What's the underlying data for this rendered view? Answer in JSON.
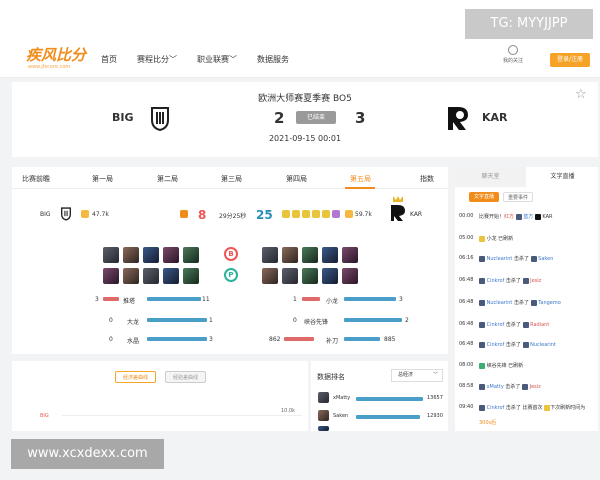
{
  "watermarks": {
    "top_right": "TG: MYYJJPP",
    "bottom_left": "www.xcxdexx.com"
  },
  "header": {
    "logo": "疾风比分",
    "logo_sub": "www.jfscore.com",
    "nav": [
      "首页",
      "赛程比分",
      "职业联赛",
      "数据服务"
    ],
    "follow_label": "我的关注",
    "login_label": "登录/注册"
  },
  "match": {
    "title": "欧洲大师赛夏季赛 BO5",
    "team_left": "BIG",
    "team_right": "KAR",
    "score_left": "2",
    "score_right": "3",
    "status": "已结束",
    "time": "2021-09-15 00:01"
  },
  "stats": {
    "tabs": [
      "比赛前瞻",
      "第一局",
      "第二局",
      "第三局",
      "第四局",
      "第五局",
      "指数"
    ],
    "active_tab": "第五局",
    "summary": {
      "left_team": "BIG",
      "left_gold": "47.7k",
      "left_kills": "8",
      "duration": "29分25秒",
      "right_kills": "25",
      "right_gold": "59.7k",
      "right_team": "KAR"
    },
    "side_badges": [
      "B",
      "P"
    ],
    "left_bars": [
      {
        "value": "3",
        "label": "推塔",
        "right_value": "11"
      },
      {
        "value": "0",
        "label": "大龙",
        "right_value": "1"
      },
      {
        "value": "0",
        "label": "水晶",
        "right_value": "3"
      }
    ],
    "right_bars": [
      {
        "value": "1",
        "label": "小龙",
        "right_value": "3"
      },
      {
        "value": "0",
        "label": "峡谷先锋",
        "right_value": "2"
      },
      {
        "value": "862",
        "label": "补刀",
        "right_value": "885"
      }
    ]
  },
  "graph": {
    "btn_economy": "经济差曲线",
    "btn_exp": "经验差曲线",
    "team_label": "BIG",
    "axis_label": "10.0k"
  },
  "rank": {
    "title": "数据排名",
    "select": "总经济",
    "rows": [
      {
        "name": "xMatty",
        "value": "13657"
      },
      {
        "name": "Saken",
        "value": "12930"
      }
    ]
  },
  "live": {
    "tab_chat": "聊天室",
    "tab_live": "文字直播",
    "chip_live": "文字直播",
    "chip_event": "重要事件",
    "events": [
      {
        "time": "00:00",
        "pre": "比赛开始！",
        "a": "红方",
        "mid": "",
        "b": "蓝方",
        "post": "KAR"
      },
      {
        "time": "05:00",
        "pre": "",
        "a": "",
        "mid": "小龙  已刷新",
        "b": "",
        "post": ""
      },
      {
        "time": "06:16",
        "pre": "",
        "a": "Nuclearint",
        "mid": "击杀了",
        "b": "Saken",
        "post": ""
      },
      {
        "time": "06:48",
        "pre": "",
        "a": "Cinkrof",
        "mid": "击杀了",
        "b": "Jesiz",
        "post": ""
      },
      {
        "time": "06:48",
        "pre": "",
        "a": "Nuclearint",
        "mid": "击杀了",
        "b": "Tangemo",
        "post": ""
      },
      {
        "time": "06:48",
        "pre": "",
        "a": "Cinkrof",
        "mid": "击杀了",
        "b": "Radiant",
        "post": ""
      },
      {
        "time": "06:48",
        "pre": "",
        "a": "Cinkrof",
        "mid": "击杀了",
        "b": "Nuclearint",
        "post": ""
      },
      {
        "time": "08:00",
        "pre": "",
        "a": "",
        "mid": "峡谷先锋  已刷新",
        "b": "",
        "post": ""
      },
      {
        "time": "08:58",
        "pre": "",
        "a": "xMatty",
        "mid": "击杀了",
        "b": "Jesiz",
        "post": ""
      },
      {
        "time": "09:40",
        "pre": "",
        "a": "Cinkrof",
        "mid": "击杀了  比赛首次",
        "b": "",
        "post": "下次刷新时间为"
      }
    ],
    "last_line": "300s后"
  },
  "colors": {
    "accent": "#f08c1a",
    "red_bar": "#e06a6a",
    "blue_bar": "#4a9fc9"
  }
}
